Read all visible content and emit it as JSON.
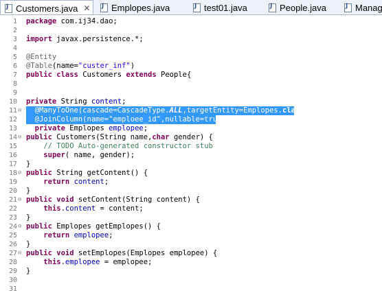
{
  "tabs": [
    {
      "label": "Customers.java",
      "active": true,
      "dirty": false,
      "close": "✕"
    },
    {
      "label": "Emplopes.java"
    },
    {
      "label": "test01.java"
    },
    {
      "label": "People.java"
    },
    {
      "label": "Manag"
    }
  ],
  "lines": [
    {
      "n": "1",
      "html": "<span class='kw'>package</span> com.ij34.dao;"
    },
    {
      "n": "2",
      "html": ""
    },
    {
      "n": "3",
      "html": "<span class='kw'>import</span> javax.persistence.*;"
    },
    {
      "n": "4",
      "html": ""
    },
    {
      "n": "5",
      "html": "<span class='ann'>@Entity</span>"
    },
    {
      "n": "6",
      "html": "<span class='ann'>@Table</span>(name=<span class='str'>\"custer_inf\"</span>)"
    },
    {
      "n": "7",
      "html": "<span class='kw'>public</span> <span class='kw'>class</span> Customers <span class='kw'>extends</span> People{"
    },
    {
      "n": "8",
      "html": ""
    },
    {
      "n": "9",
      "html": ""
    },
    {
      "n": "10",
      "html": "<span class='kw'>private</span> String <span class='fld'>content</span>;"
    },
    {
      "n": "11",
      "fold": "⊖",
      "selected": true,
      "html": "  @ManyToOne(cascade=CascadeType.<span class='ital'>ALL</span>,targetEntity=Emplopes.<span class='kw'>class</span>)"
    },
    {
      "n": "12",
      "selected": true,
      "html": "  @JoinColumn(name=\"emploee_id\",nullable=true)"
    },
    {
      "n": "13",
      "html": "  <span class='kw'>private</span> Emplopes <span class='fld'>emplopee</span>;"
    },
    {
      "n": "14",
      "fold": "⊖",
      "html": "<span class='kw'>public</span> Customers(String name,<span class='kw'>char</span> gender) {"
    },
    {
      "n": "15",
      "html": "    <span class='cmt'>// TODO Auto-generated constructor stub</span>"
    },
    {
      "n": "16",
      "html": "    <span class='kw'>super</span>( name, gender);"
    },
    {
      "n": "17",
      "html": "}"
    },
    {
      "n": "18",
      "fold": "⊖",
      "html": "<span class='kw'>public</span> String getContent() {"
    },
    {
      "n": "19",
      "html": "    <span class='kw'>return</span> <span class='fld'>content</span>;"
    },
    {
      "n": "20",
      "html": "}"
    },
    {
      "n": "21",
      "fold": "⊖",
      "html": "<span class='kw'>public</span> <span class='kw'>void</span> setContent(String content) {"
    },
    {
      "n": "22",
      "html": "    <span class='kw'>this</span>.<span class='fld'>content</span> = content;"
    },
    {
      "n": "23",
      "html": "}"
    },
    {
      "n": "24",
      "fold": "⊖",
      "html": "<span class='kw'>public</span> Emplopes getEmplopes() {"
    },
    {
      "n": "25",
      "html": "    <span class='kw'>return</span> <span class='fld'>emplopee</span>;"
    },
    {
      "n": "26",
      "html": "}"
    },
    {
      "n": "27",
      "fold": "⊖",
      "html": "<span class='kw'>public</span> <span class='kw'>void</span> setEmplopes(Emplopes emplopee) {"
    },
    {
      "n": "28",
      "html": "    <span class='kw'>this</span>.<span class='fld'>emplopee</span> = emplopee;"
    },
    {
      "n": "29",
      "html": "}"
    },
    {
      "n": "30",
      "html": ""
    },
    {
      "n": "31",
      "html": ""
    }
  ]
}
